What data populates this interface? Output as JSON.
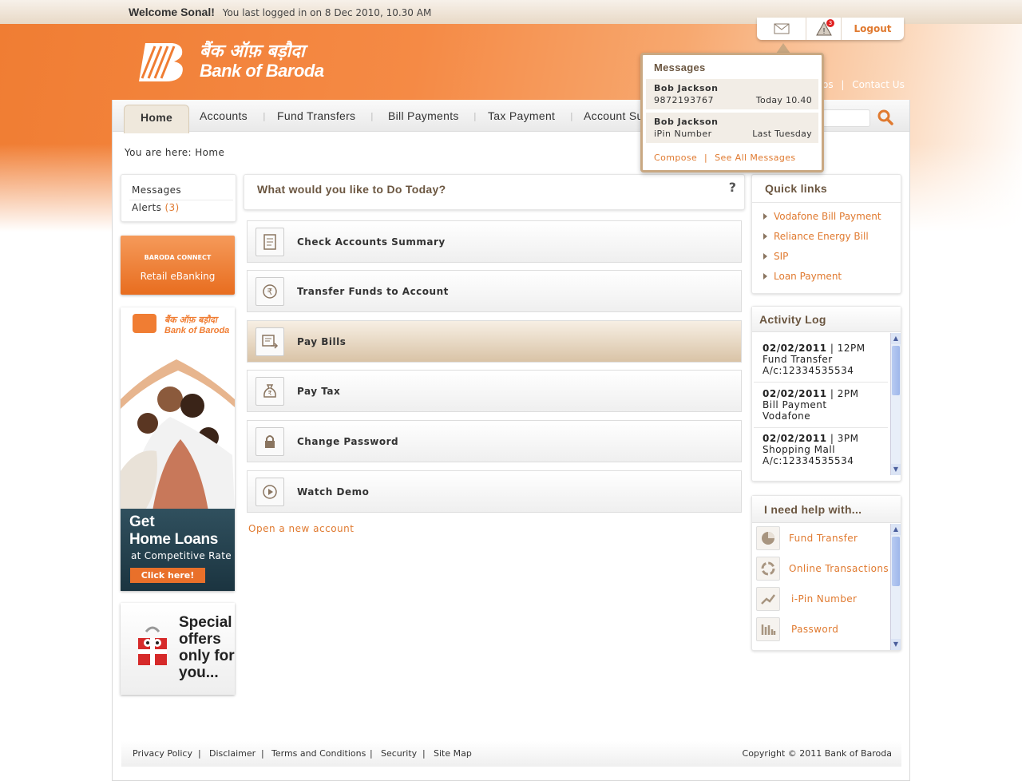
{
  "topbar": {
    "welcome": "Welcome Sonal!",
    "last_login": "You last logged in on 8 Dec 2010, 10.30 AM"
  },
  "brand": {
    "name_hindi": "बैंक ऑफ़ बड़ौदा",
    "name_en": "Bank of Baroda",
    "color": "#f07d33"
  },
  "util": {
    "mail_icon": "mail-icon",
    "alert_icon": "alert-icon",
    "alert_count": "3",
    "logout": "Logout"
  },
  "toplinks": {
    "partial": "os",
    "contact": "Contact Us"
  },
  "nav": {
    "items": [
      "Home",
      "Accounts",
      "Fund Transfers",
      "Bill Payments",
      "Tax Payment",
      "Account Su"
    ]
  },
  "breadcrumb": {
    "prefix": "You are here:",
    "current": "Home"
  },
  "left": {
    "messages": "Messages",
    "alerts": "Alerts",
    "alerts_count": "(3)",
    "banner": {
      "line1": "BARODA CONNECT",
      "line2": "Retail eBanking"
    },
    "ad": {
      "hindi": "बैंक ऑफ़ बड़ौदा",
      "brand": "Bank of Baroda",
      "get": "Get",
      "title": "Home Loans",
      "sub": "at Competitive Rate",
      "cta": "Click here!"
    },
    "offer": {
      "l1": "Special",
      "l2": "offers",
      "l3": "only for",
      "l4": "you..."
    }
  },
  "center": {
    "title": "What would you like to Do Today?",
    "help": "?",
    "tasks": [
      {
        "label": "Check Accounts Summary",
        "icon": "document-icon"
      },
      {
        "label": "Transfer Funds to Account",
        "icon": "rupee-transfer-icon"
      },
      {
        "label": "Pay Bills",
        "icon": "bill-icon"
      },
      {
        "label": "Pay Tax",
        "icon": "rupee-bag-icon"
      },
      {
        "label": "Change Password",
        "icon": "lock-icon"
      },
      {
        "label": "Watch Demo",
        "icon": "play-icon"
      }
    ],
    "open_account": "Open a new account"
  },
  "quick_links": {
    "title": "Quick links",
    "items": [
      "Vodafone Bill Payment",
      "Reliance Energy Bill",
      "SIP",
      "Loan Payment"
    ]
  },
  "activity": {
    "title": "Activity Log",
    "entries": [
      {
        "date": "02/02/2011",
        "time": "12PM",
        "desc": "Fund Transfer",
        "detail": "A/c:12334535534"
      },
      {
        "date": "02/02/2011",
        "time": "2PM",
        "desc": "Bill Payment",
        "detail": "Vodafone"
      },
      {
        "date": "02/02/2011",
        "time": "3PM",
        "desc": "Shopping Mall",
        "detail": "A/c:12334535534"
      }
    ]
  },
  "help": {
    "title": "I need help with...",
    "items": [
      "Fund Transfer",
      "Online Transactions",
      "i-Pin Number",
      "Password"
    ]
  },
  "messages_popup": {
    "title": "Messages",
    "items": [
      {
        "from": "Bob Jackson",
        "sub": "9872193767",
        "when": "Today 10.40"
      },
      {
        "from": "Bob Jackson",
        "sub": "iPin Number",
        "when": "Last Tuesday"
      }
    ],
    "compose": "Compose",
    "see_all": "See All Messages"
  },
  "footer": {
    "links": [
      "Privacy Policy",
      "Disclaimer",
      "Terms and Conditions",
      "Security",
      "Site Map"
    ],
    "copyright": "Copyright © 2011 Bank of Baroda"
  }
}
